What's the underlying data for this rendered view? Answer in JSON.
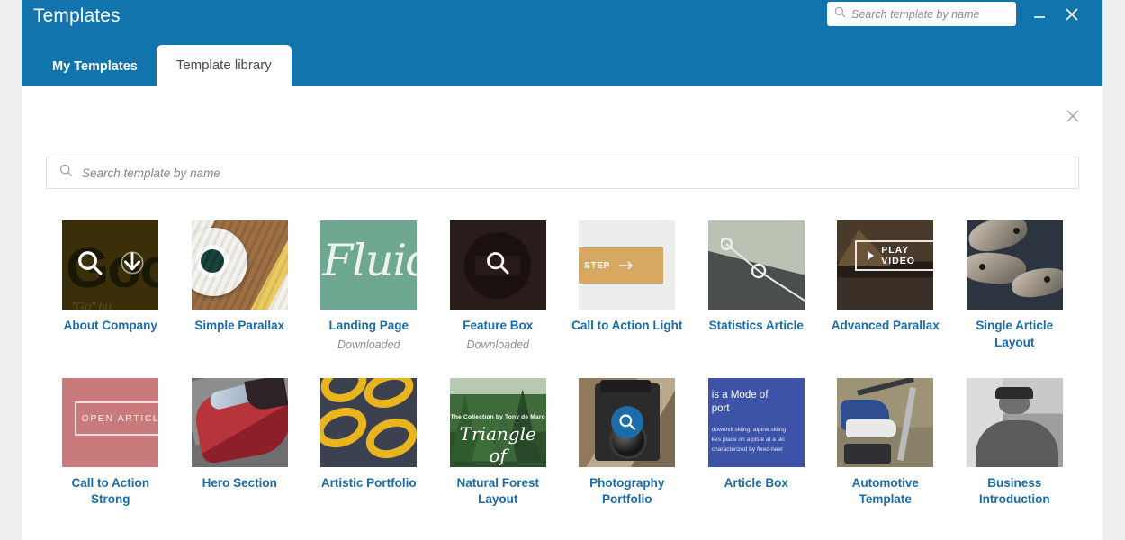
{
  "colors": {
    "header_blue": "#1274ad",
    "link_blue": "#1b6ca8",
    "backdrop_gray": "#efeff0",
    "status_gray": "#8d8d8d",
    "panel_white": "#ffffff"
  },
  "window": {
    "title": "Templates",
    "minimize_label": "Minimize",
    "close_label": "Close"
  },
  "header_search": {
    "placeholder": "Search template by name",
    "value": "",
    "icon": "search-icon"
  },
  "tabs": [
    {
      "label": "My Templates",
      "active": false
    },
    {
      "label": "Template library",
      "active": true
    }
  ],
  "panel": {
    "close_label": "Close panel"
  },
  "main_search": {
    "placeholder": "Search template by name",
    "value": "",
    "icon": "search-icon"
  },
  "templates": [
    {
      "title": "About Company",
      "status": "",
      "art": "art-about",
      "thumb_text_primary": "Goo",
      "thumb_text_secondary": "\"Go\" bu",
      "overlay": "search-and-download",
      "overlay_icons": [
        "search-icon",
        "download-icon"
      ]
    },
    {
      "title": "Simple Parallax",
      "status": "",
      "art": "art-wood",
      "overlay": "none"
    },
    {
      "title": "Landing Page",
      "status": "Downloaded",
      "art": "art-fluid",
      "thumb_text_primary": "Fluid",
      "overlay": "none"
    },
    {
      "title": "Feature Box",
      "status": "Downloaded",
      "art": "art-featurebox",
      "overlay": "search-plain",
      "overlay_icons": [
        "search-icon"
      ]
    },
    {
      "title": "Call to Action Light",
      "status": "",
      "art": "art-cta-light",
      "thumb_text_primary": "STEP",
      "overlay": "none"
    },
    {
      "title": "Statistics Article",
      "status": "",
      "art": "art-stats",
      "overlay": "none"
    },
    {
      "title": "Advanced Parallax",
      "status": "",
      "art": "art-parallax",
      "thumb_text_primary": "PLAY VIDEO",
      "overlay": "none"
    },
    {
      "title": "Single Article Layout",
      "status": "",
      "art": "art-fish",
      "overlay": "none"
    },
    {
      "title": "Call to Action Strong",
      "status": "",
      "art": "art-cta-strong",
      "thumb_text_primary": "OPEN ARTICLE",
      "overlay": "none"
    },
    {
      "title": "Hero Section",
      "status": "",
      "art": "art-hero",
      "overlay": "none"
    },
    {
      "title": "Artistic Portfolio",
      "status": "",
      "art": "art-artistic",
      "overlay": "none"
    },
    {
      "title": "Natural Forest Layout",
      "status": "",
      "art": "art-forest",
      "thumb_text_secondary": "The Collection by Tony de Maro",
      "thumb_text_primary": "Triangle of",
      "overlay": "none"
    },
    {
      "title": "Photography Portfolio",
      "status": "",
      "art": "art-photo",
      "overlay": "search-circle",
      "overlay_icons": [
        "search-icon"
      ]
    },
    {
      "title": "Article Box",
      "status": "",
      "art": "art-articlebox",
      "thumb_text_primary": "is a Mode of\nport",
      "thumb_text_secondary": "downhill skiing, alpine skiing\nkes place on a piste at a ski\ncharacterized by fixed-heel",
      "overlay": "none"
    },
    {
      "title": "Automotive Template",
      "status": "",
      "art": "art-auto",
      "overlay": "none"
    },
    {
      "title": "Business Introduction",
      "status": "",
      "art": "art-business",
      "overlay": "none"
    }
  ]
}
